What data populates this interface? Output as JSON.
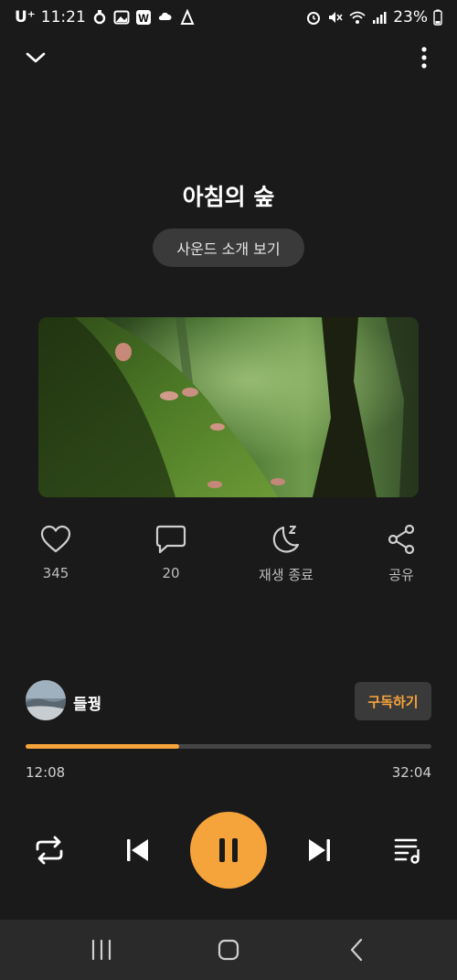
{
  "status_bar": {
    "carrier": "U⁺",
    "time": "11:21",
    "battery": "23%"
  },
  "track": {
    "title": "아침의 숲",
    "intro_button": "사운드 소개 보기"
  },
  "actions": {
    "like_count": "345",
    "comment_count": "20",
    "sleep_label": "재생 종료",
    "share_label": "공유"
  },
  "channel": {
    "name": "들꿩",
    "subscribe_label": "구독하기"
  },
  "playback": {
    "current_time": "12:08",
    "total_time": "32:04",
    "progress_fraction": 0.378
  },
  "colors": {
    "accent": "#f5a33b",
    "background": "#1a1a1a",
    "pill": "#3a3a3a"
  },
  "icons": {
    "collapse": "chevron-down-icon",
    "more": "more-vertical-icon",
    "like": "heart-icon",
    "comment": "comment-icon",
    "sleep": "moon-icon",
    "share": "share-icon",
    "repeat": "repeat-icon",
    "prev": "skip-previous-icon",
    "pause": "pause-icon",
    "next": "skip-next-icon",
    "playlist": "playlist-icon"
  }
}
